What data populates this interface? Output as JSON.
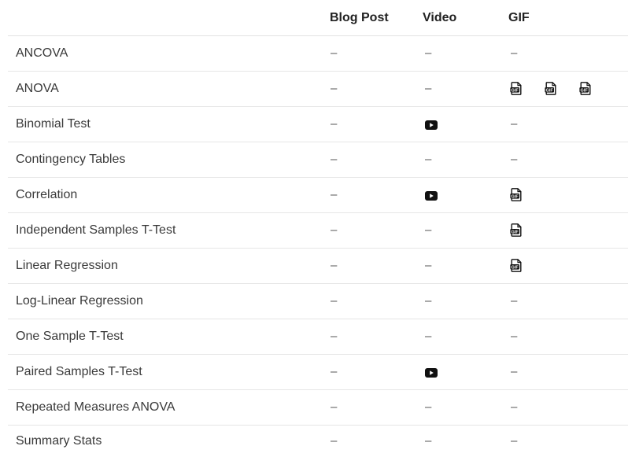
{
  "headers": {
    "name": "",
    "blog": "Blog Post",
    "video": "Video",
    "gif": "GIF"
  },
  "dash": "–",
  "icons": {
    "video": "youtube-play-icon",
    "gif": "gif-file-icon"
  },
  "colors": {
    "text": "#3a3a3a",
    "header_text": "#222222",
    "icon": "#111111",
    "row_border": "#e6e6e6"
  },
  "rows": [
    {
      "name": "ANCOVA",
      "blog": "–",
      "video": "–",
      "gif_count": 0,
      "video_count": 0
    },
    {
      "name": "ANOVA",
      "blog": "–",
      "video": "–",
      "gif_count": 3,
      "video_count": 0
    },
    {
      "name": "Binomial Test",
      "blog": "–",
      "video": "",
      "gif_count": 0,
      "video_count": 1
    },
    {
      "name": "Contingency Tables",
      "blog": "–",
      "video": "–",
      "gif_count": 0,
      "video_count": 0
    },
    {
      "name": "Correlation",
      "blog": "–",
      "video": "",
      "gif_count": 1,
      "video_count": 1
    },
    {
      "name": "Independent Samples T-Test",
      "blog": "–",
      "video": "–",
      "gif_count": 1,
      "video_count": 0
    },
    {
      "name": "Linear Regression",
      "blog": "–",
      "video": "–",
      "gif_count": 1,
      "video_count": 0
    },
    {
      "name": "Log-Linear Regression",
      "blog": "–",
      "video": "–",
      "gif_count": 0,
      "video_count": 0
    },
    {
      "name": "One Sample T-Test",
      "blog": "–",
      "video": "–",
      "gif_count": 0,
      "video_count": 0
    },
    {
      "name": "Paired Samples T-Test",
      "blog": "–",
      "video": "",
      "gif_count": 0,
      "video_count": 1
    },
    {
      "name": "Repeated Measures ANOVA",
      "blog": "–",
      "video": "–",
      "gif_count": 0,
      "video_count": 0
    },
    {
      "name": "Summary Stats",
      "blog": "–",
      "video": "–",
      "gif_count": 0,
      "video_count": 0
    }
  ]
}
